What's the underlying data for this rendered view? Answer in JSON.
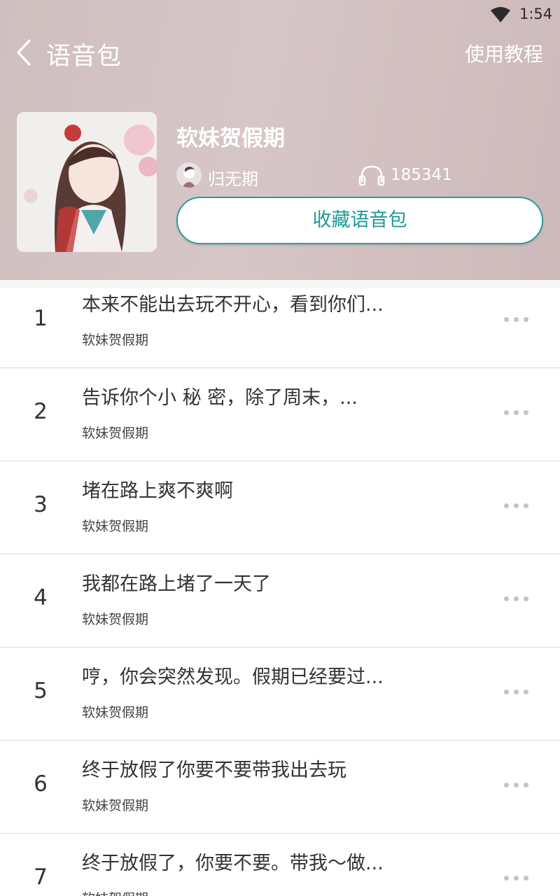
{
  "status_bar": {
    "time": "1:54",
    "icons": [
      "wifi-icon"
    ]
  },
  "nav": {
    "back_icon": "chevron-left-icon",
    "title": "语音包",
    "tutorial_label": "使用教程"
  },
  "pack": {
    "name": "软妹贺假期",
    "author": "归无期",
    "play_count": "185341",
    "collect_label": "收藏语音包",
    "accent_color": "#1e9899"
  },
  "list": {
    "items": [
      {
        "index": "1",
        "title": "本来不能出去玩不开心，看到你们...",
        "subtitle": "软妹贺假期"
      },
      {
        "index": "2",
        "title": "告诉你个小 秘 密，除了周末，...",
        "subtitle": "软妹贺假期"
      },
      {
        "index": "3",
        "title": "堵在路上爽不爽啊",
        "subtitle": "软妹贺假期"
      },
      {
        "index": "4",
        "title": "我都在路上堵了一天了",
        "subtitle": "软妹贺假期"
      },
      {
        "index": "5",
        "title": "哼，你会突然发现。假期已经要过...",
        "subtitle": "软妹贺假期"
      },
      {
        "index": "6",
        "title": "终于放假了你要不要带我出去玩",
        "subtitle": "软妹贺假期"
      },
      {
        "index": "7",
        "title": "终于放假了，你要不要。带我～做...",
        "subtitle": "软妹贺假期"
      }
    ]
  }
}
